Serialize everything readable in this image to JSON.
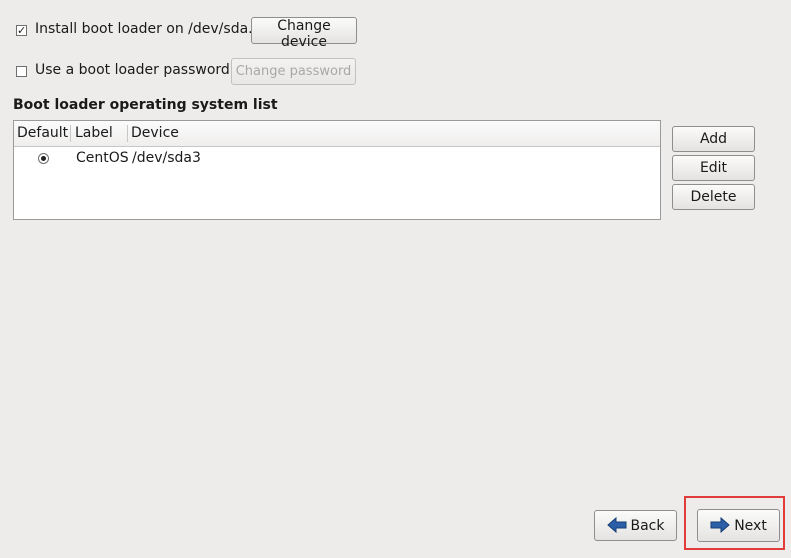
{
  "bootloader": {
    "install_checked": true,
    "install_label": "Install boot loader on /dev/sda.",
    "change_device_label": "Change device",
    "password_checked": false,
    "password_label": "Use a boot loader password",
    "change_password_label": "Change password"
  },
  "os_list": {
    "title": "Boot loader operating system list",
    "columns": [
      "Default",
      "Label",
      "Device"
    ],
    "rows": [
      {
        "default": true,
        "label": "CentOS",
        "device": "/dev/sda3"
      }
    ],
    "add_label": "Add",
    "edit_label": "Edit",
    "delete_label": "Delete"
  },
  "navigation": {
    "back_label": "Back",
    "next_label": "Next",
    "back_icon": "arrow-left-icon",
    "next_icon": "arrow-right-icon"
  },
  "colors": {
    "background": "#edeceb",
    "arrow_blue": "#2b5fa8",
    "highlight_red": "#e23b3b"
  }
}
